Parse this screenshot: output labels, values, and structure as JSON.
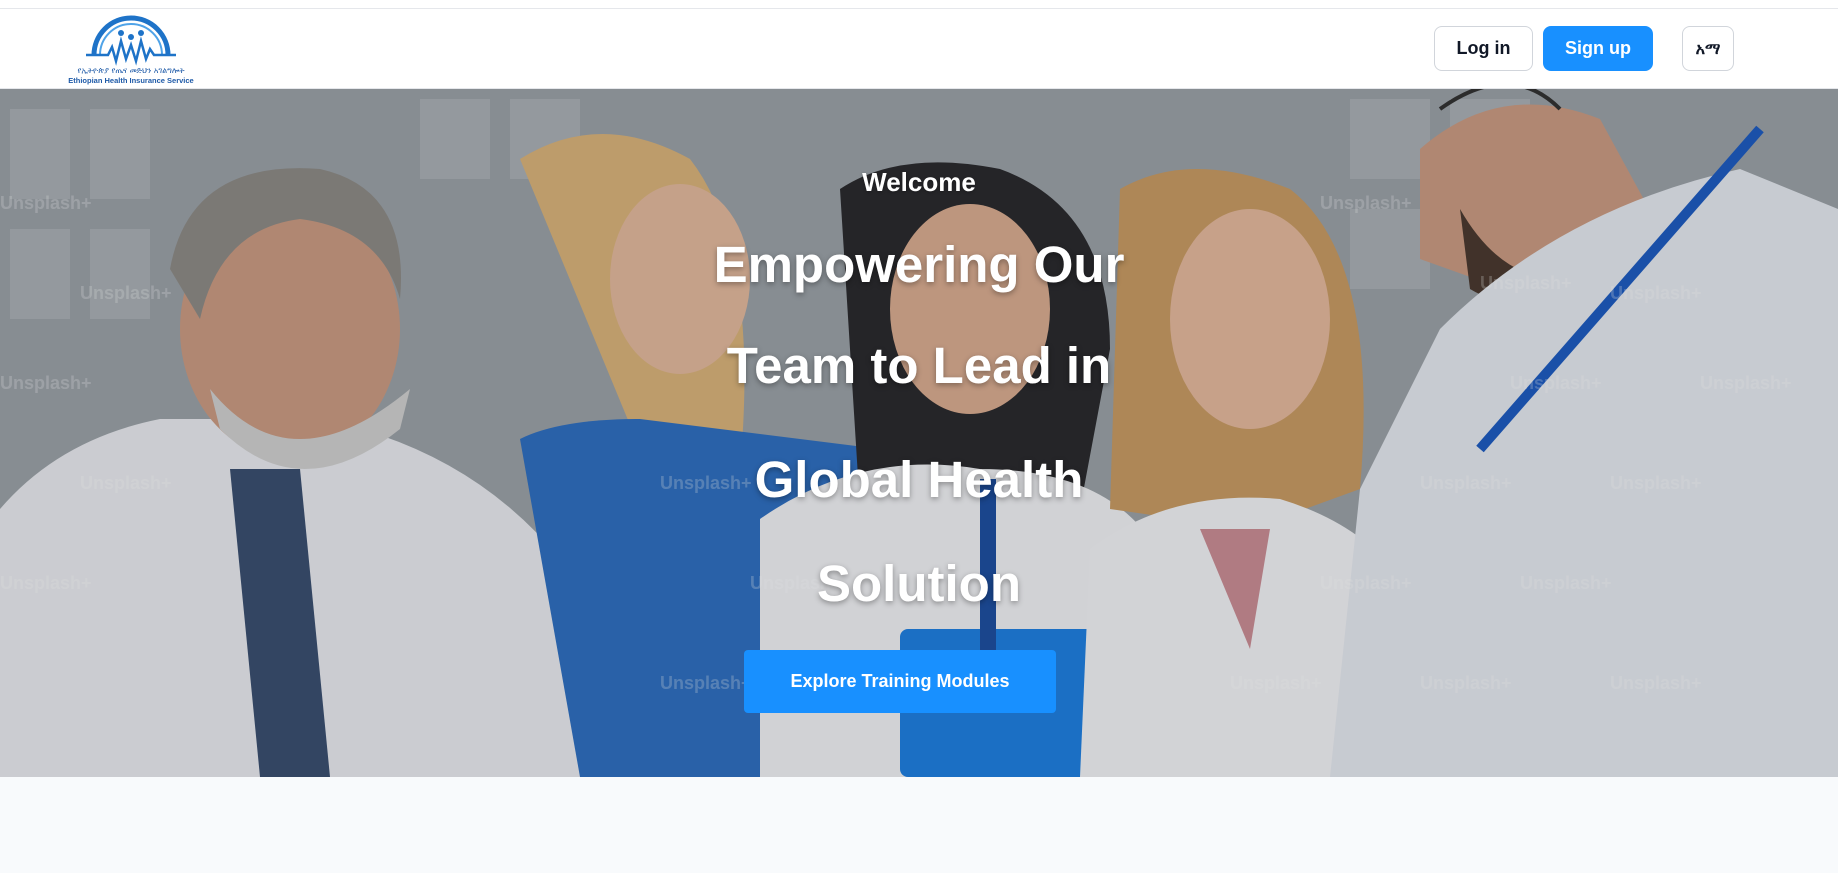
{
  "header": {
    "logo": {
      "name_amharic": "የኢትዮጵያ የጤና መድህን አገልግሎት",
      "name_english": "Ethiopian Health Insurance Service",
      "icon": "ehis-logo-icon"
    },
    "login_label": "Log in",
    "signup_label": "Sign up",
    "language_label": "አማ"
  },
  "hero": {
    "welcome": "Welcome",
    "title_lines": [
      "Empowering Our",
      "Team to Lead in",
      "Global Health",
      "Solution"
    ],
    "cta_label": "Explore Training Modules",
    "background_image": "medical-team-photo"
  },
  "colors": {
    "primary": "#1890ff",
    "header_bg": "#ffffff",
    "page_bg": "#f8fafc"
  }
}
